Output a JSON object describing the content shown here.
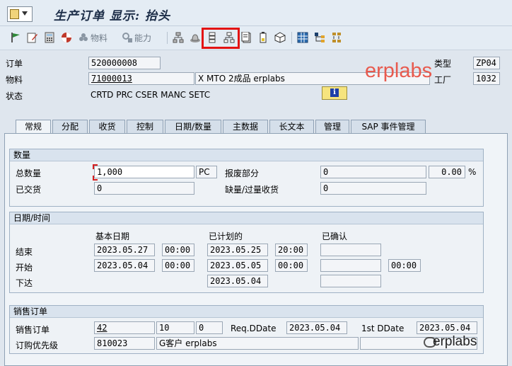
{
  "window": {
    "title": "生产订单 显示: 抬头",
    "title_icon": "document-dropdown-icon"
  },
  "toolbar": {
    "items": [
      {
        "name": "flag-icon"
      },
      {
        "name": "edit-icon"
      },
      {
        "name": "calculator-icon"
      },
      {
        "name": "color-wheel-icon"
      },
      {
        "name": "material-button",
        "label": "物料"
      },
      {
        "name": "capacity-button",
        "label": "能力"
      },
      {
        "name": "structure-icon"
      },
      {
        "name": "hat-icon"
      },
      {
        "name": "sequence-icon"
      },
      {
        "name": "hierarchy-icon"
      },
      {
        "name": "document-icon"
      },
      {
        "name": "battery-icon"
      },
      {
        "name": "cube-icon"
      },
      {
        "name": "grid-icon"
      },
      {
        "name": "network-icon"
      },
      {
        "name": "sort-icon"
      }
    ]
  },
  "header": {
    "order_label": "订单",
    "order_value": "520000008",
    "type_label": "类型",
    "type_value": "ZP04",
    "material_label": "物料",
    "material_value": "71000013",
    "material_desc": "X MTO 2成品 erplabs",
    "plant_label": "工厂",
    "plant_value": "1032",
    "status_label": "状态",
    "status_value": "CRTD PRC  CSER MANC SETC",
    "info_glyph": "i"
  },
  "watermark": {
    "main": "erplabs",
    "corner": "erplabs"
  },
  "tabs": [
    "常规",
    "分配",
    "收货",
    "控制",
    "日期/数量",
    "主数据",
    "长文本",
    "管理",
    "SAP 事件管理"
  ],
  "quantity": {
    "group_title": "数量",
    "total_label": "总数量",
    "total_value": "1,000",
    "unit": "PC",
    "scrap_label": "报废部分",
    "scrap_value": "0",
    "scrap_pct": "0.00",
    "pct_sign": "%",
    "delivered_label": "已交货",
    "delivered_value": "0",
    "shortage_label": "缺量/过量收货",
    "shortage_value": "0"
  },
  "dates": {
    "group_title": "日期/时间",
    "col_basic": "基本日期",
    "col_scheduled": "已计划的",
    "col_confirmed": "已确认",
    "end_label": "结束",
    "end_basic_date": "2023.05.27",
    "end_basic_time": "00:00",
    "end_sched_date": "2023.05.25",
    "end_sched_time": "20:00",
    "start_label": "开始",
    "start_basic_date": "2023.05.04",
    "start_basic_time": "00:00",
    "start_sched_date": "2023.05.05",
    "start_sched_time": "00:00",
    "start_conf_time": "00:00",
    "release_label": "下达",
    "release_sched_date": "2023.05.04"
  },
  "sales": {
    "group_title": "销售订单",
    "so_label": "销售订单",
    "so_value": "42",
    "item_value": "10",
    "schedule_value": "0",
    "reqdd_label": "Req.DDate",
    "reqdd_value": "2023.05.04",
    "firstdd_label": "1st DDate",
    "firstdd_value": "2023.05.04",
    "priority_label": "订购优先级",
    "priority_value": "810023",
    "customer_value": "G客户 erplabs"
  }
}
